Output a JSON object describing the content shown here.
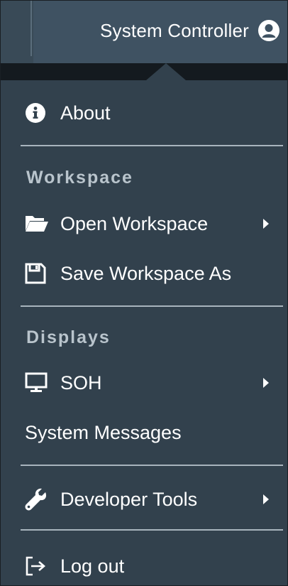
{
  "header": {
    "user_menu_label": "System Controller",
    "user_icon": "user-circle-icon"
  },
  "menu": {
    "about": {
      "label": "About",
      "icon": "info-circle-icon"
    },
    "workspace_header": "Workspace",
    "open_workspace": {
      "label": "Open Workspace",
      "icon": "folder-open-icon",
      "has_submenu": true
    },
    "save_workspace_as": {
      "label": "Save Workspace As",
      "icon": "save-icon"
    },
    "displays_header": "Displays",
    "soh": {
      "label": "SOH",
      "icon": "desktop-icon",
      "has_submenu": true
    },
    "system_messages": {
      "label": "System Messages"
    },
    "developer_tools": {
      "label": "Developer Tools",
      "icon": "wrench-icon",
      "has_submenu": true
    },
    "log_out": {
      "label": "Log out",
      "icon": "log-out-icon"
    }
  },
  "colors": {
    "menu_background": "#32414d",
    "header_background": "#3f5262",
    "section_header_text": "#b9c4cc",
    "divider": "#a8b4bd",
    "text": "#ffffff"
  }
}
